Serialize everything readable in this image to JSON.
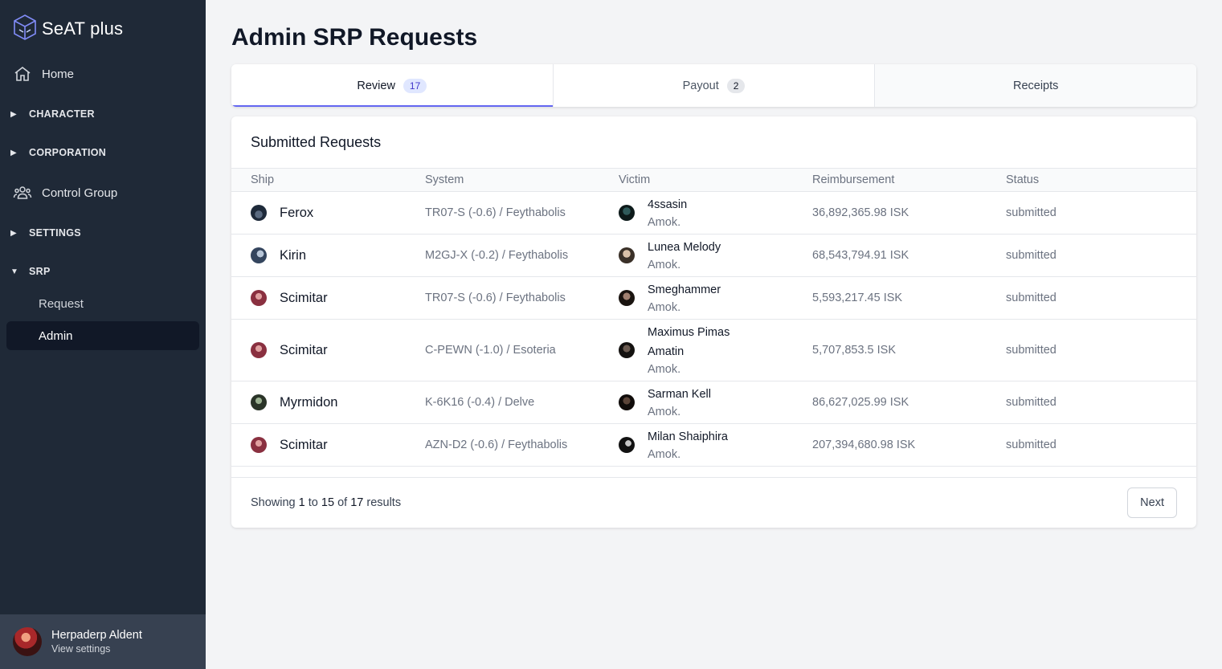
{
  "brand": {
    "name": "SeAT plus"
  },
  "nav": {
    "home": "Home",
    "sections": {
      "character": "CHARACTER",
      "corporation": "CORPORATION",
      "settings": "SETTINGS",
      "srp": "SRP"
    },
    "control_group": "Control Group",
    "srp_items": {
      "request": "Request",
      "admin": "Admin"
    }
  },
  "user": {
    "name": "Herpaderp Aldent",
    "sub": "View settings"
  },
  "page": {
    "title": "Admin SRP Requests"
  },
  "tabs": {
    "review": {
      "label": "Review",
      "count": "17"
    },
    "payout": {
      "label": "Payout",
      "count": "2"
    },
    "receipts": {
      "label": "Receipts"
    }
  },
  "card": {
    "title": "Submitted Requests"
  },
  "table": {
    "headers": {
      "ship": "Ship",
      "system": "System",
      "victim": "Victim",
      "reimbursement": "Reimbursement",
      "status": "Status"
    },
    "rows": [
      {
        "ship": "Ferox",
        "system": "TR07-S (-0.6) / Feythabolis",
        "victim": "4ssasin",
        "corp": "Amok.",
        "reimbursement": "36,892,365.98 ISK",
        "status": "submitted"
      },
      {
        "ship": "Kirin",
        "system": "M2GJ-X (-0.2) / Feythabolis",
        "victim": "Lunea Melody",
        "corp": "Amok.",
        "reimbursement": "68,543,794.91 ISK",
        "status": "submitted"
      },
      {
        "ship": "Scimitar",
        "system": "TR07-S (-0.6) / Feythabolis",
        "victim": "Smeghammer",
        "corp": "Amok.",
        "reimbursement": "5,593,217.45 ISK",
        "status": "submitted"
      },
      {
        "ship": "Scimitar",
        "system": "C-PEWN (-1.0) / Esoteria",
        "victim": "Maximus Pimas Amatin",
        "corp": "Amok.",
        "reimbursement": "5,707,853.5 ISK",
        "status": "submitted"
      },
      {
        "ship": "Myrmidon",
        "system": "K-6K16 (-0.4) / Delve",
        "victim": "Sarman Kell",
        "corp": "Amok.",
        "reimbursement": "86,627,025.99 ISK",
        "status": "submitted"
      },
      {
        "ship": "Scimitar",
        "system": "AZN-D2 (-0.6) / Feythabolis",
        "victim": "Milan Shaiphira",
        "corp": "Amok.",
        "reimbursement": "207,394,680.98 ISK",
        "status": "submitted"
      }
    ]
  },
  "footer": {
    "showing_prefix": "Showing",
    "from": "1",
    "to_word": "to",
    "to": "15",
    "of_word": "of",
    "total": "17",
    "results_word": "results",
    "next": "Next"
  },
  "colors": {
    "sidebar": "#1f2937",
    "accent": "#6366f1",
    "user_box": "#374151"
  }
}
